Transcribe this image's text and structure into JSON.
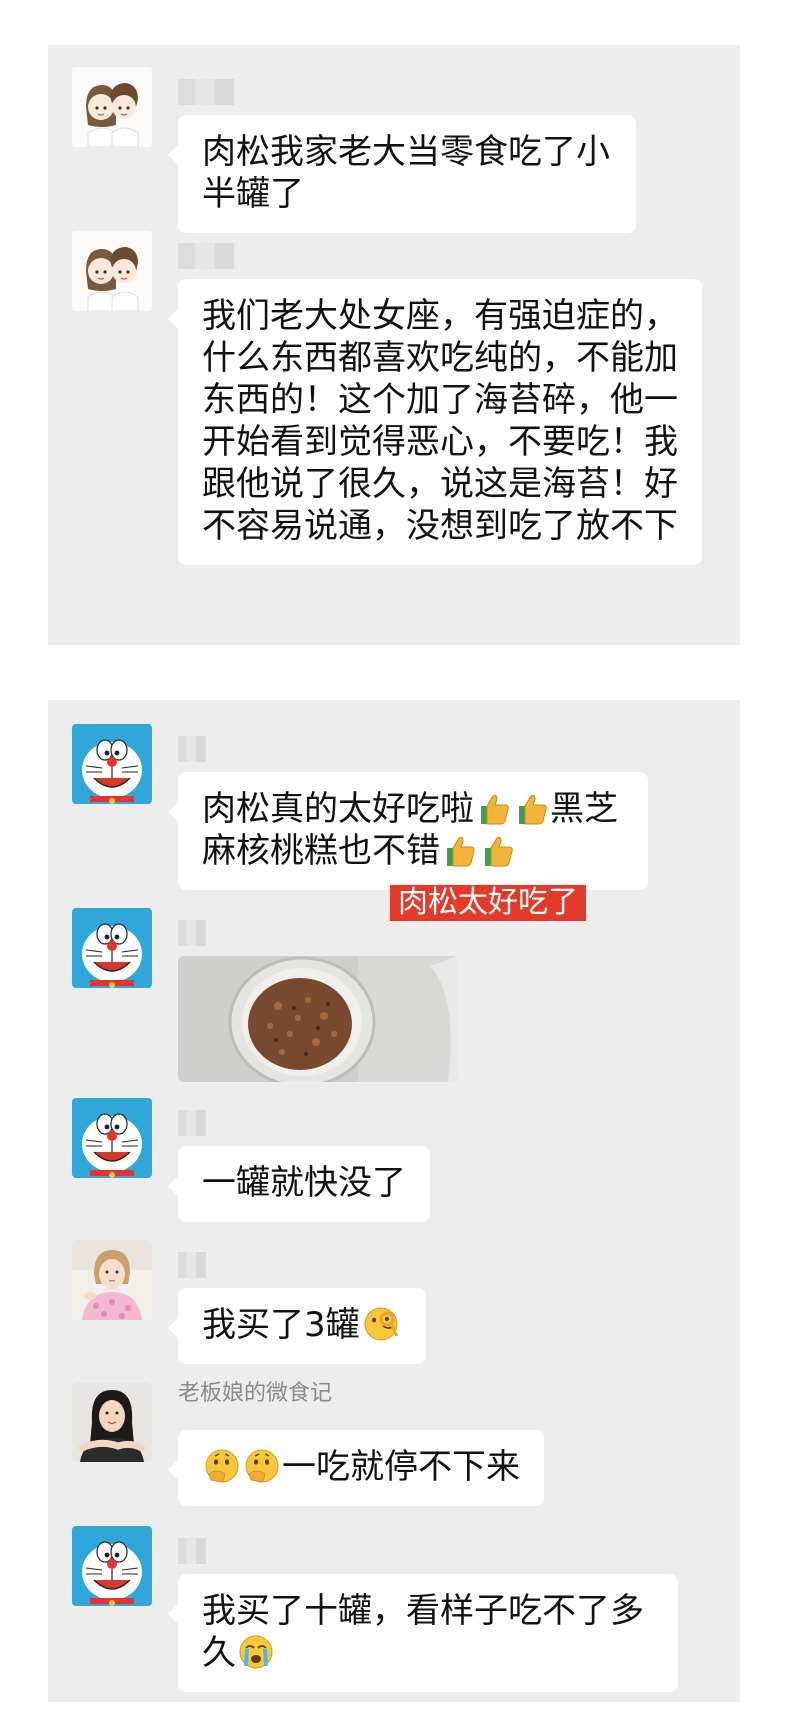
{
  "panel1": {
    "messages": [
      {
        "sender": "",
        "text": "肉松我家老大当零食吃了小半罐了"
      },
      {
        "sender": "",
        "text": "我们老大处女座，有强迫症的，什么东西都喜欢吃纯的，不能加东西的！这个加了海苔碎，他一开始看到觉得恶心，不要吃！我跟他说了很久，说这是海苔！好不容易说通，没想到吃了放不下"
      }
    ]
  },
  "panel2": {
    "caption": "肉松太好吃了",
    "messages": [
      {
        "sender": "",
        "text_a": "肉松真的太好吃啦",
        "text_b": "黑芝麻核桃糕也不错",
        "emoji": "thumbs-up"
      },
      {
        "sender": "",
        "type": "image",
        "image": "rousong-jar-photo"
      },
      {
        "sender": "",
        "text": "一罐就快没了"
      },
      {
        "sender": "",
        "text": "我买了3罐",
        "emoji": "ok-hand-face"
      },
      {
        "sender": "老板娘的微食记",
        "text": "一吃就停不下来",
        "emoji": "thinking-face"
      },
      {
        "sender": "",
        "text": "我买了十罐，看样子吃不了多久",
        "emoji": "crying-face"
      }
    ]
  },
  "colors": {
    "panel_bg": "#ededed",
    "bubble_bg": "#ffffff",
    "caption_bg": "#e33a2a",
    "thumb": "#f3b43a",
    "cuff": "#3aa157"
  }
}
